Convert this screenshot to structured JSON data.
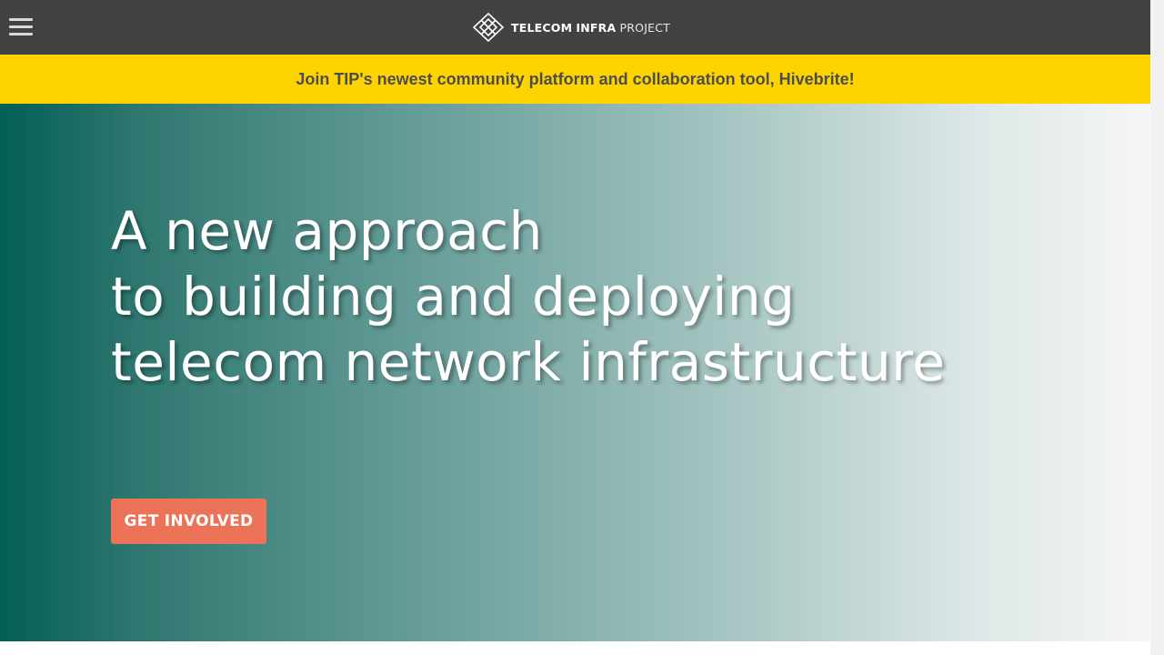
{
  "header": {
    "menu_icon": "hamburger-menu-icon",
    "logo": {
      "icon": "tip-diamond-logo-icon",
      "word1": "TELECOM",
      "word2": "INFRA",
      "word3": "PROJECT"
    }
  },
  "announcement": {
    "text": "Join TIP's newest community platform and collaboration tool, Hivebrite!"
  },
  "hero": {
    "headline_lines": [
      "A new approach",
      "to building and deploying",
      "telecom network infrastructure"
    ],
    "cta_label": "GET INVOLVED"
  },
  "colors": {
    "header_bg": "#424242",
    "announcement_bg": "#fdd400",
    "announcement_text": "#4d4d4d",
    "hero_gradient_start": "#035f55",
    "hero_gradient_end": "#f6f6f6",
    "cta_bg": "#ec7358"
  }
}
